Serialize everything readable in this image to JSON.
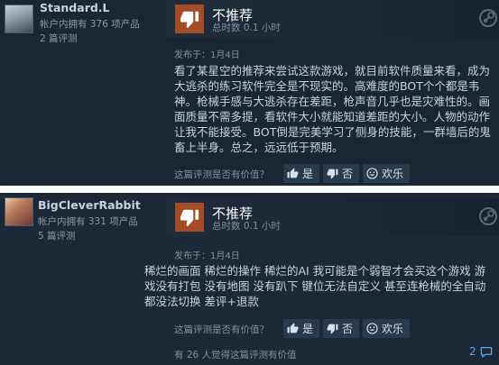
{
  "reviews": [
    {
      "author": {
        "name": "Standard.L",
        "owned": "帐户内拥有 376 项产品",
        "count": "2 篇评测"
      },
      "verdict": "不推荐",
      "hours": "总时数 0.1 小时",
      "posted": "发布于：1月4日",
      "text": "看了某星空的推荐来尝试这款游戏，就目前软件质量来看，成为大逃杀的练习软件完全是不现实的。高难度的BOT个个都是韦神。枪械手感与大逃杀存在差距，枪声音几乎也是灾难性的。画面质量不需多提，看软件大小就能知道差距的大小。人物的动作让我不能接受。BOT倒是完美学习了侧身的技能，一群墙后的鬼畜上半身。总之，远远低于预期。",
      "helpful_question": "这篇评测是否有价值？",
      "buttons": {
        "yes": "是",
        "no": "否",
        "funny": "欢乐"
      }
    },
    {
      "author": {
        "name": "BigCleverRabbit",
        "owned": "帐户内拥有 331 项产品",
        "count": "5 篇评测"
      },
      "verdict": "不推荐",
      "hours": "总时数 0.1 小时",
      "posted": "发布于：1月4日",
      "text": "稀烂的画面 稀烂的操作 稀烂的AI 我可能是个弱智才会买这个游戏 游戏没有打包 没有地图 没有趴下 键位无法自定义 甚至连枪械的全自动都没法切换 差评+退款",
      "helpful_question": "这篇评测是否有价值？",
      "buttons": {
        "yes": "是",
        "no": "否",
        "funny": "欢乐"
      },
      "found_helpful": "有 26 人觉得这篇评测有价值",
      "comment_count": "2"
    }
  ],
  "colors": {
    "thumb_down": "#a34c25",
    "link": "#5aa9ea",
    "panel": "#1b2634",
    "button": "#283a4d"
  },
  "icons": {
    "verdict": "thumbs-down-icon",
    "platform": "steam-icon",
    "yes": "thumbs-up-icon",
    "no": "thumbs-down-icon",
    "funny": "laugh-icon",
    "comments": "comment-icon"
  }
}
